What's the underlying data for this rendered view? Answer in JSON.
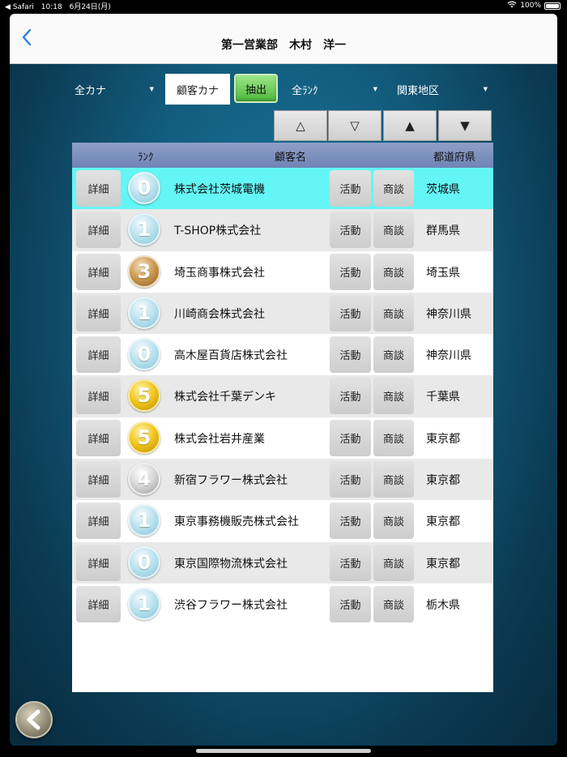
{
  "status_bar": {
    "back_app": "◀ Safari",
    "time": "10:18",
    "date": "6月24日(月)",
    "battery": "100%"
  },
  "nav": {
    "title": "第一営業部　木村　洋一"
  },
  "filters": {
    "kana_all": "全カナ",
    "customer_kana": "顧客カナ",
    "extract": "抽出",
    "rank_all": "全ﾗﾝｸ",
    "region": "関東地区",
    "sort_buttons": [
      "△",
      "▽",
      "▲",
      "▼"
    ]
  },
  "table": {
    "headers": {
      "rank": "ﾗﾝｸ",
      "name": "顧客名",
      "pref": "都道府県"
    },
    "detail_label": "詳細",
    "activity_label": "活動",
    "deal_label": "商談",
    "rows": [
      {
        "rank": "0",
        "name": "株式会社茨城電機",
        "pref": "茨城県"
      },
      {
        "rank": "1",
        "name": "T-SHOP株式会社",
        "pref": "群馬県"
      },
      {
        "rank": "3",
        "name": "埼玉商事株式会社",
        "pref": "埼玉県"
      },
      {
        "rank": "1",
        "name": "川崎商会株式会社",
        "pref": "神奈川県"
      },
      {
        "rank": "0",
        "name": "高木屋百貨店株式会社",
        "pref": "神奈川県"
      },
      {
        "rank": "5",
        "name": "株式会社千葉デンキ",
        "pref": "千葉県"
      },
      {
        "rank": "5",
        "name": "株式会社岩井産業",
        "pref": "東京都"
      },
      {
        "rank": "4",
        "name": "新宿フラワー株式会社",
        "pref": "東京都"
      },
      {
        "rank": "1",
        "name": "東京事務機販売株式会社",
        "pref": "東京都"
      },
      {
        "rank": "0",
        "name": "東京国際物流株式会社",
        "pref": "東京都"
      },
      {
        "rank": "1",
        "name": "渋谷フラワー株式会社",
        "pref": "栃木県"
      }
    ]
  },
  "colors": {
    "selected_row": "#64f6f6",
    "header_bg": "#7d90bf",
    "extract_button": "#6fd05a",
    "back_link": "#1a7df2"
  }
}
